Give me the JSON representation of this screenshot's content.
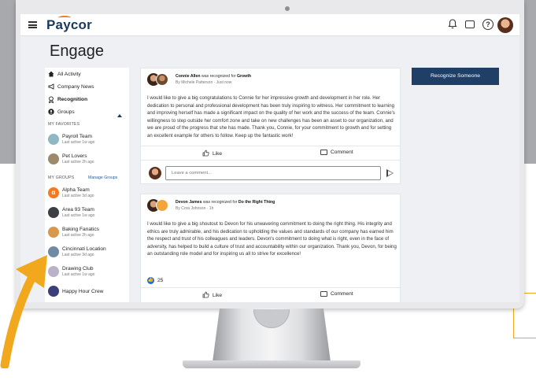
{
  "app": {
    "logo": "Paycor",
    "page_title": "Engage"
  },
  "colors": {
    "brand_navy": "#1f3f66",
    "accent_orange": "#f47a20",
    "arrow_yellow": "#f2a81d",
    "link_blue": "#1f5b9c"
  },
  "topbar": {
    "icons": [
      "bell-icon",
      "chat-icon",
      "help-icon",
      "user-avatar"
    ],
    "help_glyph": "?"
  },
  "sidebar": {
    "nav": [
      {
        "label": "All Activity",
        "icon": "home-icon"
      },
      {
        "label": "Company News",
        "icon": "megaphone-icon"
      },
      {
        "label": "Recognition",
        "icon": "award-icon"
      },
      {
        "label": "Groups",
        "icon": "groups-icon"
      }
    ],
    "favorites_label": "MY FAVORITES",
    "favorites": [
      {
        "name": "Payroll Team",
        "status": "Last active 1w ago",
        "color": "#8fb8c4"
      },
      {
        "name": "Pet Lovers",
        "status": "Last active 2h ago",
        "color": "#9c8a6a"
      }
    ],
    "groups_label": "MY GROUPS",
    "manage_label": "Manage Groups",
    "groups": [
      {
        "name": "Alpha Team",
        "status": "Last active 3d ago",
        "color": "#f47a20"
      },
      {
        "name": "Area 93 Team",
        "status": "Last active 1w ago",
        "color": "#3b3f44"
      },
      {
        "name": "Baking Fanatics",
        "status": "Last active 2h ago",
        "color": "#d89a4a"
      },
      {
        "name": "Cincinnati Location",
        "status": "Last active 3d ago",
        "color": "#6f8aa3"
      },
      {
        "name": "Drawing Club",
        "status": "Last active 1w ago",
        "color": "#b9b2c8"
      },
      {
        "name": "Happy Hour Crew",
        "status": "",
        "color": "#3a3f7a"
      }
    ]
  },
  "posts": [
    {
      "author": "Connie Allen",
      "action": " was recognized for ",
      "category": "Growth",
      "byline": "By Michele Patterson · Just now",
      "body": "I would like to give a big congratulations to Connie for her impressive growth and development in her role. Her dedication to personal and professional development has been truly inspiring to witness. Her commitment to learning and improving herself has made a significant impact on the quality of her work and the success of the team. Connie's willingness to step outside her comfort zone and take on new challenges has been an asset to our organization, and we are proud of the progress that she has made. Thank you, Connie, for your commitment to growth and for setting an excellent example for others to follow. Keep up the fantastic work!",
      "like_label": "Like",
      "comment_label": "Comment",
      "comment_placeholder": "Leave a comment..."
    },
    {
      "author": "Devon James",
      "action": " was recognized for ",
      "category": "Do the Right Thing",
      "byline": "By Cora Johnson · 1h",
      "body": "I would like to give a big shoutout to Devon for his unwavering commitment to doing the right thing. His integrity and ethics are truly admirable, and his dedication to upholding the values and standards of our company has earned him the respect and trust of his colleagues and leaders. Devon's commitment to doing what is right, even in the face of adversity, has helped to build a culture of trust and accountability within our organization. Thank you, Devon, for being an outstanding role model and for inspiring us all to strive for excellence!",
      "reaction_count": "25",
      "like_label": "Like",
      "comment_label": "Comment"
    }
  ],
  "recognize_button": "Recognize Someone"
}
